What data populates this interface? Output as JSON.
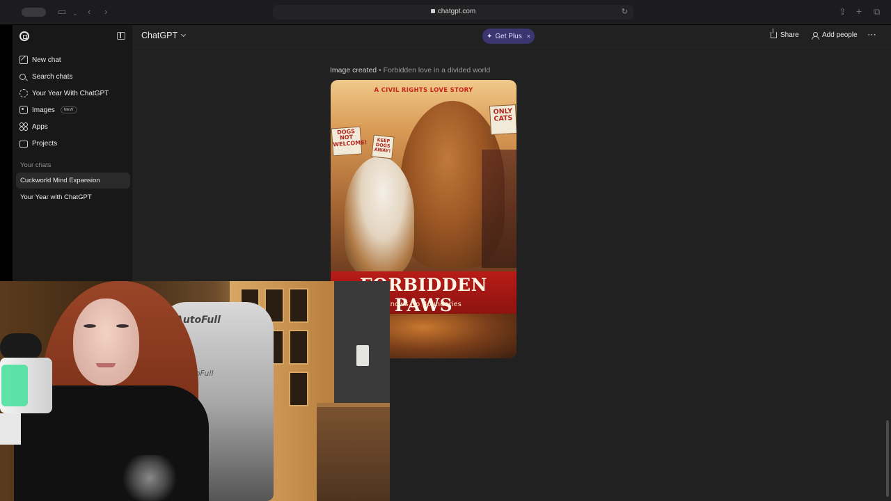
{
  "browser": {
    "url": "chatgpt.com"
  },
  "header": {
    "model_label": "ChatGPT",
    "get_plus_label": "Get Plus",
    "get_plus_close": "×",
    "share_label": "Share",
    "add_people_label": "Add people",
    "more_label": "⋯"
  },
  "sidebar": {
    "items": [
      {
        "label": "New chat",
        "icon": "new-chat-icon"
      },
      {
        "label": "Search chats",
        "icon": "search-icon"
      },
      {
        "label": "Your Year With ChatGPT",
        "icon": "year-icon"
      },
      {
        "label": "Images",
        "icon": "images-icon",
        "badge": "NEW"
      },
      {
        "label": "Apps",
        "icon": "apps-icon"
      },
      {
        "label": "Projects",
        "icon": "projects-icon"
      }
    ],
    "section_label": "Your chats",
    "chats": [
      {
        "label": "Cuckworld Mind Expansion",
        "active": true
      },
      {
        "label": "Your Year with ChatGPT",
        "active": false
      }
    ]
  },
  "message": {
    "status": "Image created",
    "separator": "•",
    "caption": "Forbidden love in a divided world"
  },
  "poster": {
    "tagline": "A CIVIL RIGHTS LOVE STORY",
    "sign_left": "DOGS NOT WELCOME!",
    "sign_middle": "KEEP DOGS AWAY!",
    "sign_right": "ONLY CATS",
    "title": "FORBIDDEN PAWS",
    "subtitle": "Knows No Boundaries"
  },
  "webcam": {
    "chair_brand": "AutoFull",
    "chair_brand_2": "AutoFull"
  },
  "colors": {
    "app_bg": "#212121",
    "sidebar_bg": "#181818",
    "get_plus_bg": "#3b3670",
    "poster_red": "#b81c18"
  }
}
